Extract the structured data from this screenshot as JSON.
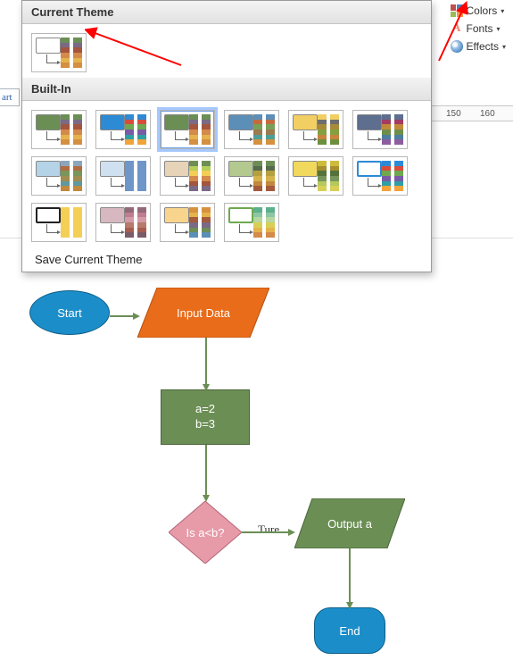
{
  "ribbon": {
    "colors_label": "Colors",
    "fonts_label": "Fonts",
    "effects_label": "Effects"
  },
  "ruler": {
    "t150": "150",
    "t160": "160"
  },
  "left_tag": "art",
  "theme_panel": {
    "current_header": "Current Theme",
    "builtin_header": "Built-In",
    "save_label": "Save Current Theme",
    "current": {
      "colors": [
        "#6b8e55",
        "#7a6a86",
        "#a4553d",
        "#d38a4a",
        "#e5b34b",
        "#d48f42"
      ]
    },
    "themes": [
      {
        "box": "#6b8e55",
        "colors": [
          "#6b8e55",
          "#7a6a86",
          "#a4553d",
          "#d38a4a",
          "#e5b34b",
          "#d48f42"
        ]
      },
      {
        "box": "#2d8bd6",
        "colors": [
          "#2d8bd6",
          "#d94b3b",
          "#6fa84f",
          "#7a5ba6",
          "#2ea0a4",
          "#f2a33a"
        ]
      },
      {
        "box": "#6b8e55",
        "colors": [
          "#6b8e55",
          "#7a6a86",
          "#a4553d",
          "#d38a4a",
          "#e5b34b",
          "#d48f42"
        ],
        "selected": true
      },
      {
        "box": "#5b8fb8",
        "colors": [
          "#5b8fb8",
          "#c36b3f",
          "#78a05a",
          "#9c7b4e",
          "#4e9e98",
          "#d6913f"
        ]
      },
      {
        "box": "#f2cf63",
        "colors": [
          "#f2cf63",
          "#6e6e6e",
          "#a88b39",
          "#84a03f",
          "#c8833c",
          "#6c8f3d"
        ]
      },
      {
        "box": "#5d6e8e",
        "colors": [
          "#5d6e8e",
          "#a33b63",
          "#c1893a",
          "#6e8e4a",
          "#4c7ea0",
          "#8c5ea0"
        ]
      },
      {
        "box": "#b5d3e7",
        "colors": [
          "#8aa6bd",
          "#b36b3f",
          "#79955b",
          "#a08c4f",
          "#5d99a0",
          "#c2883e"
        ]
      },
      {
        "box": "#cfe1f0",
        "colors": [
          "#6f96c8",
          "#6f96c8",
          "#6f96c8",
          "#6f96c8",
          "#6f96c8",
          "#6f96c8"
        ]
      },
      {
        "box": "#e6d3b8",
        "colors": [
          "#6f8e55",
          "#b6ce5c",
          "#f3cf56",
          "#d38a4a",
          "#a4553d",
          "#7a6a86"
        ]
      },
      {
        "box": "#b3c98f",
        "colors": [
          "#6f8e55",
          "#556b4a",
          "#b5a03f",
          "#d3b34a",
          "#c2883e",
          "#a45a3d"
        ]
      },
      {
        "box": "#f0d95d",
        "colors": [
          "#cfbb3c",
          "#a68f2e",
          "#547239",
          "#77955b",
          "#b6c85c",
          "#d7cf56"
        ]
      },
      {
        "box": "#ffffff",
        "outline": "#2d8bd6",
        "colors": [
          "#2d8bd6",
          "#d94b3b",
          "#6fa84f",
          "#7a5ba6",
          "#2ea0a4",
          "#f2a33a"
        ]
      },
      {
        "box": "#ffffff",
        "outline": "#222222",
        "colors": [
          "#f3cf56",
          "#f3cf56",
          "#f3cf56",
          "#f3cf56",
          "#f3cf56",
          "#f3cf56"
        ]
      },
      {
        "box": "#d8b8c0",
        "colors": [
          "#946a7a",
          "#c07d8f",
          "#d49aa8",
          "#b87a6a",
          "#a65d4f",
          "#7a5b6a"
        ]
      },
      {
        "box": "#f8d48c",
        "colors": [
          "#d6913f",
          "#e5b34b",
          "#a45a3d",
          "#7a6a86",
          "#6b8e55",
          "#5b8fb8"
        ]
      },
      {
        "box": "#ffffff",
        "outline": "#6fa84f",
        "colors": [
          "#5db08c",
          "#8cc6a4",
          "#b6d7a0",
          "#d7cf56",
          "#e5b34b",
          "#d38a4a"
        ]
      }
    ]
  },
  "flowchart": {
    "start": "Start",
    "input": "Input Data",
    "proc_l1": "a=2",
    "proc_l2": "b=3",
    "decision": "Is a<b?",
    "edge_true": "Ture",
    "output": "Output a",
    "end": "End"
  }
}
